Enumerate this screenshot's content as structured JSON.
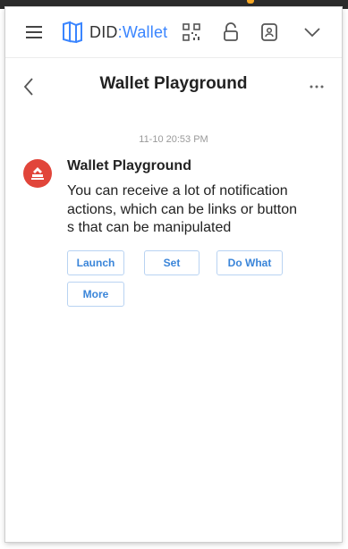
{
  "app": {
    "logo_text_prefix": "DID",
    "logo_text_separator": ":",
    "logo_text_suffix": "Wallet",
    "brand_color": "#3a85ff"
  },
  "header": {
    "title": "Wallet Playground"
  },
  "message": {
    "timestamp": "11-10 20:53 PM",
    "title": "Wallet Playground",
    "body_lines": [
      "You can receive a lot of notification",
      "actions, which can be links or button",
      "s that can be manipulated"
    ],
    "avatar_color": "#e1453a"
  },
  "actions": [
    {
      "label": "Launch"
    },
    {
      "label": "Set"
    },
    {
      "label": "Do What"
    },
    {
      "label": "More"
    }
  ],
  "icons": [
    "menu-icon",
    "qr-code-icon",
    "lock-icon",
    "id-card-icon",
    "chevron-down-icon",
    "back-arrow-icon",
    "more-options-icon",
    "app-logo-icon"
  ]
}
